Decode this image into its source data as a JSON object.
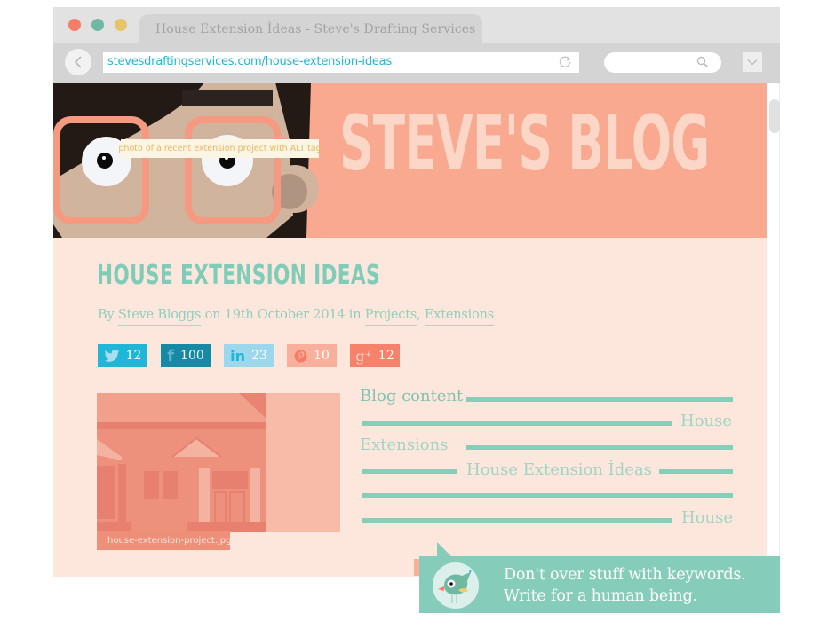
{
  "browser": {
    "tab_title": "House Extension İdeas - Steve's Drafting Services",
    "url": "stevesdraftingservices.com/house-extension-ideas",
    "search_placeholder": "",
    "icons": {
      "back": "chevron-left-icon",
      "reload": "reload-icon",
      "search": "search-icon",
      "menu": "chevron-down-icon"
    }
  },
  "banner": {
    "blog_title": "STEVE'S BLOG"
  },
  "post": {
    "title": "HOUSE EXTENSION IDEAS",
    "byline": {
      "prefix": "By ",
      "author": "Steve Bloggs",
      "date_text": " on 19th October 2014 in ",
      "category_1": "Projects",
      "separator": ", ",
      "category_2": "Extensions"
    },
    "shares": [
      {
        "network": "twitter",
        "icon": "twitter-icon",
        "glyph": "🐦",
        "count": "12"
      },
      {
        "network": "facebook",
        "icon": "facebook-icon",
        "glyph": "f",
        "count": "100"
      },
      {
        "network": "linkedin",
        "icon": "linkedin-icon",
        "glyph": "in",
        "count": "23"
      },
      {
        "network": "pinterest",
        "icon": "pinterest-icon",
        "glyph": "Ⓟ",
        "count": "10"
      },
      {
        "network": "google-plus",
        "icon": "google-plus-icon",
        "glyph": "g⁺",
        "count": "12"
      }
    ],
    "image": {
      "alt_text": "photo of a recent extension project with ALT tag",
      "filename": "house-extension-project.jpg"
    },
    "content_keywords": {
      "line1": "Blog content",
      "line2": "House",
      "line3": "Extensions",
      "line4": "House Extension İdeas",
      "line6": "House"
    }
  },
  "tip": {
    "line1": "Don't  over stuff with keywords.",
    "line2": "Write for a human being."
  },
  "colors": {
    "banner": "#f8a98f",
    "page_bg": "#fde6dc",
    "accent_teal": "#86ccba",
    "link_blue": "#1fb6d8"
  }
}
